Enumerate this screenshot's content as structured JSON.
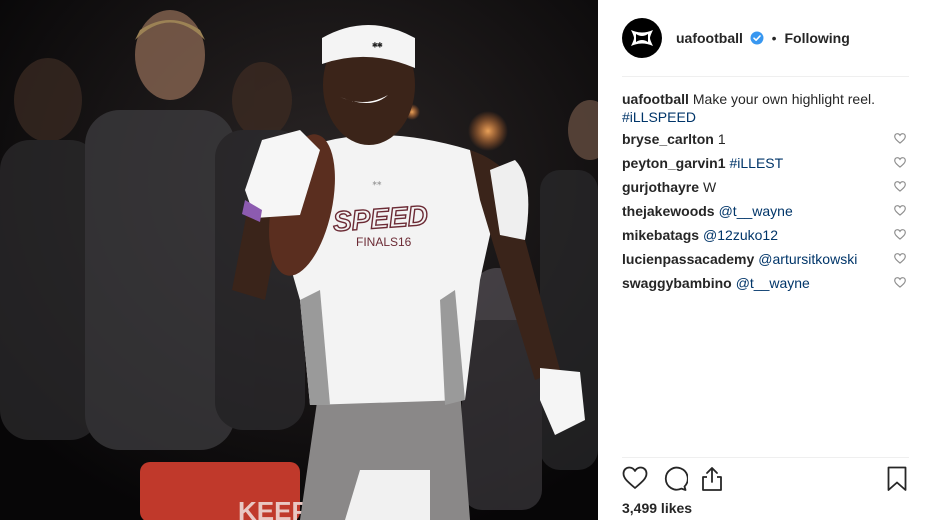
{
  "post": {
    "username": "uafootball",
    "follow_status": "Following",
    "dot": "•",
    "caption_text": "Make your own highlight reel.",
    "caption_hashtag": "#iLLSPEED",
    "likes": "3,499 likes",
    "shirt_text_top": "SPEED",
    "shirt_text_bottom": "FINALS16"
  },
  "comments": [
    {
      "user": "bryse_carlton",
      "text": "1",
      "mention": ""
    },
    {
      "user": "peyton_garvin1",
      "text": "",
      "mention": "#iLLEST"
    },
    {
      "user": "gurjothayre",
      "text": "W",
      "mention": ""
    },
    {
      "user": "thejakewoods",
      "text": "",
      "mention": "@t__wayne"
    },
    {
      "user": "mikebatags",
      "text": "",
      "mention": "@12zuko12"
    },
    {
      "user": "lucienpassacademy",
      "text": "",
      "mention": "@artursitkowski"
    },
    {
      "user": "swaggybambino",
      "text": "",
      "mention": "@t__wayne"
    }
  ],
  "icons": {
    "avatar": "under-armour-logo",
    "verified": "verified-badge-icon",
    "like": "heart-icon",
    "comment": "comment-bubble-icon",
    "share": "share-icon",
    "save": "bookmark-icon"
  },
  "colors": {
    "link": "#003569",
    "verified": "#3897f0",
    "text": "#262626",
    "divider": "#efefef"
  }
}
